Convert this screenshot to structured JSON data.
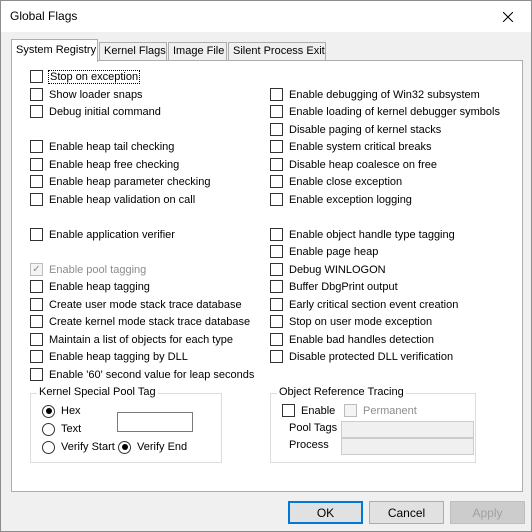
{
  "window": {
    "title": "Global Flags"
  },
  "tabs": [
    {
      "label": "System Registry"
    },
    {
      "label": "Kernel Flags"
    },
    {
      "label": "Image File"
    },
    {
      "label": "Silent Process Exit"
    }
  ],
  "left_flags": [
    {
      "label": "Stop on exception",
      "checked": false
    },
    {
      "label": "Show loader snaps",
      "checked": false
    },
    {
      "label": "Debug initial command",
      "checked": false
    },
    {
      "label": "Enable heap tail checking",
      "checked": false
    },
    {
      "label": "Enable heap free checking",
      "checked": false
    },
    {
      "label": "Enable heap parameter checking",
      "checked": false
    },
    {
      "label": "Enable heap validation on call",
      "checked": false
    },
    {
      "label": "Enable application verifier",
      "checked": false
    },
    {
      "label": "Enable pool tagging",
      "checked": true,
      "disabled": true
    },
    {
      "label": "Enable heap tagging",
      "checked": false
    },
    {
      "label": "Create user mode stack trace database",
      "checked": false
    },
    {
      "label": "Create kernel mode stack trace database",
      "checked": false
    },
    {
      "label": "Maintain a list of objects for each type",
      "checked": false
    },
    {
      "label": "Enable heap tagging by DLL",
      "checked": false
    },
    {
      "label": "Enable '60' second value for leap seconds",
      "checked": false
    }
  ],
  "right_flags": [
    {
      "label": "Enable debugging of Win32 subsystem",
      "checked": false
    },
    {
      "label": "Enable loading of kernel debugger symbols",
      "checked": false
    },
    {
      "label": "Disable paging of kernel stacks",
      "checked": false
    },
    {
      "label": "Enable system critical breaks",
      "checked": false
    },
    {
      "label": "Disable heap coalesce on free",
      "checked": false
    },
    {
      "label": "Enable close exception",
      "checked": false
    },
    {
      "label": "Enable exception logging",
      "checked": false
    },
    {
      "label": "Enable object handle type tagging",
      "checked": false
    },
    {
      "label": "Enable page heap",
      "checked": false
    },
    {
      "label": "Debug WINLOGON",
      "checked": false
    },
    {
      "label": "Buffer DbgPrint output",
      "checked": false
    },
    {
      "label": "Early critical section event creation",
      "checked": false
    },
    {
      "label": "Stop on user mode exception",
      "checked": false
    },
    {
      "label": "Enable bad handles detection",
      "checked": false
    },
    {
      "label": "Disable protected DLL verification",
      "checked": false
    }
  ],
  "pool_tag": {
    "title": "Kernel Special Pool Tag",
    "hex_label": "Hex",
    "text_label": "Text",
    "verify_start_label": "Verify Start",
    "verify_end_label": "Verify End",
    "tag_value": "",
    "selected_format": "Hex",
    "selected_verify": "Verify End"
  },
  "object_ref": {
    "title": "Object Reference Tracing",
    "enable_label": "Enable",
    "permanent_label": "Permanent",
    "pool_tags_label": "Pool Tags",
    "process_label": "Process",
    "pool_tags_value": "",
    "process_value": ""
  },
  "buttons": {
    "ok": "OK",
    "cancel": "Cancel",
    "apply": "Apply"
  }
}
